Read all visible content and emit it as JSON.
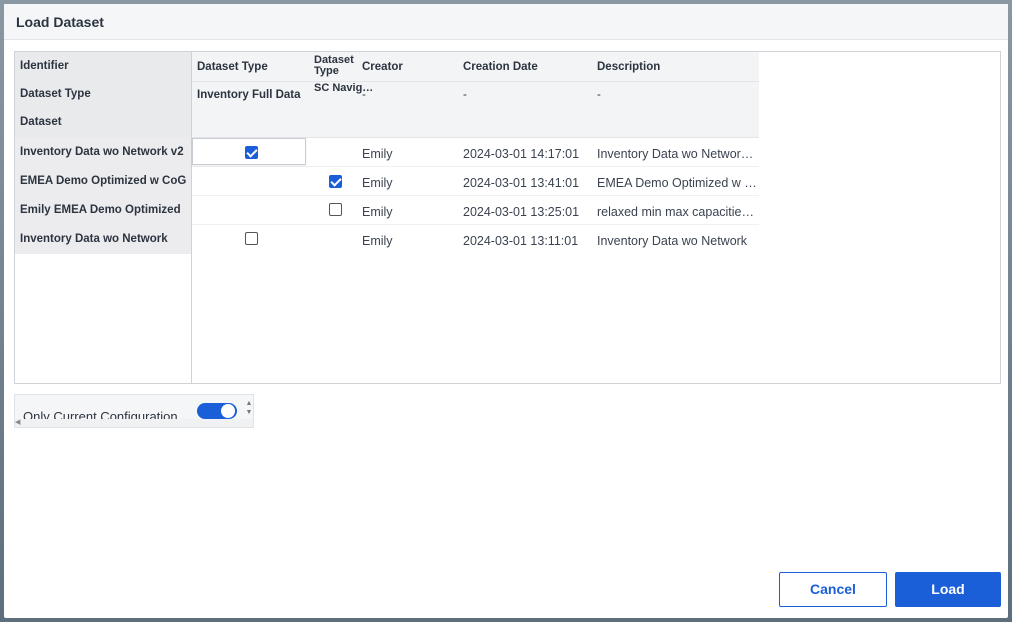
{
  "dialog": {
    "title": "Load Dataset"
  },
  "pivot": {
    "row_header_labels": [
      "Identifier",
      "Dataset Type",
      "Dataset"
    ],
    "column_headers": {
      "dataset_type_label": "Dataset Type",
      "inventory_full_data": "Inventory Full Data",
      "dataset_type_sc_top": "Dataset Type",
      "dataset_type_sc_bottom": "SC Navig…",
      "creator": "Creator",
      "creation_date": "Creation Date",
      "description": "Description",
      "dash": "-"
    },
    "rows": [
      {
        "identifier": "Inventory Data wo Network v2",
        "inventory_full_data": true,
        "sc_navig": false,
        "creator": "Emily",
        "creation_date": "2024-03-01 14:17:01",
        "description": "Inventory Data wo Networ…"
      },
      {
        "identifier": "EMEA Demo Optimized w CoG",
        "inventory_full_data": false,
        "sc_navig": true,
        "creator": "Emily",
        "creation_date": "2024-03-01 13:41:01",
        "description": "EMEA Demo Optimized w …"
      },
      {
        "identifier": "Emily EMEA Demo Optimized",
        "inventory_full_data": null,
        "sc_navig": false,
        "creator": "Emily",
        "creation_date": "2024-03-01 13:25:01",
        "description": "relaxed min max capacitie…"
      },
      {
        "identifier": "Inventory Data wo Network",
        "inventory_full_data": false,
        "sc_navig": null,
        "creator": "Emily",
        "creation_date": "2024-03-01 13:11:01",
        "description": "Inventory Data wo Network"
      }
    ]
  },
  "filter": {
    "label": "Only Current Configuration",
    "enabled": true
  },
  "footer": {
    "cancel_label": "Cancel",
    "load_label": "Load"
  },
  "colors": {
    "accent": "#1a5fd8",
    "header_bg": "#f5f6f8"
  }
}
